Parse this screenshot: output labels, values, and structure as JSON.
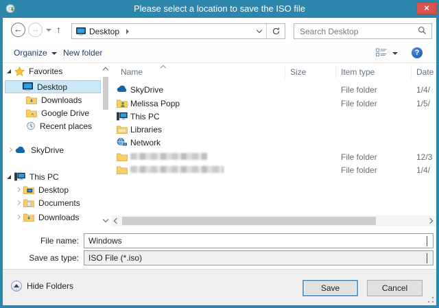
{
  "window": {
    "title": "Please select a location to save the ISO file",
    "close_glyph": "×"
  },
  "navbar": {
    "back_glyph": "←",
    "forward_glyph": "→",
    "up_glyph": "↑",
    "breadcrumb": "Desktop",
    "search_placeholder": "Search Desktop"
  },
  "toolbar": {
    "organize_label": "Organize",
    "new_folder_label": "New folder",
    "help_glyph": "?"
  },
  "sidebar": {
    "favorites_label": "Favorites",
    "favorites_items": [
      {
        "label": "Desktop",
        "selected": true
      },
      {
        "label": "Downloads",
        "selected": false
      },
      {
        "label": "Google Drive",
        "selected": false
      },
      {
        "label": "Recent places",
        "selected": false
      }
    ],
    "skydrive_label": "SkyDrive",
    "thispc_label": "This PC",
    "thispc_items": [
      {
        "label": "Desktop"
      },
      {
        "label": "Documents"
      },
      {
        "label": "Downloads"
      }
    ]
  },
  "filelist": {
    "columns": [
      "Name",
      "Size",
      "Item type",
      "Date"
    ],
    "rows": [
      {
        "name": "SkyDrive",
        "size": "",
        "type": "File folder",
        "date": "1/4/",
        "redacted": false
      },
      {
        "name": "Melissa Popp",
        "size": "",
        "type": "File folder",
        "date": "1/5/",
        "redacted": false
      },
      {
        "name": "This PC",
        "size": "",
        "type": "",
        "date": "",
        "redacted": false
      },
      {
        "name": "Libraries",
        "size": "",
        "type": "",
        "date": "",
        "redacted": false
      },
      {
        "name": "Network",
        "size": "",
        "type": "",
        "date": "",
        "redacted": false
      },
      {
        "name": "",
        "size": "",
        "type": "File folder",
        "date": "12/3",
        "redacted": true
      },
      {
        "name": "",
        "size": "",
        "type": "File folder",
        "date": "1/4/",
        "redacted": true
      }
    ]
  },
  "fields": {
    "file_name_label": "File name:",
    "file_name_value": "Windows",
    "save_type_label": "Save as type:",
    "save_type_value": "ISO File (*.iso)"
  },
  "footer": {
    "hide_folders_label": "Hide Folders",
    "save_label": "Save",
    "cancel_label": "Cancel"
  },
  "colors": {
    "titlebar": "#2d87ad",
    "close_button": "#d9534f",
    "selection_bg": "#cbe8f6",
    "selection_border": "#9bd3f0",
    "toolbar_text": "#1e3c5f",
    "muted_text": "#6d6d6d"
  }
}
